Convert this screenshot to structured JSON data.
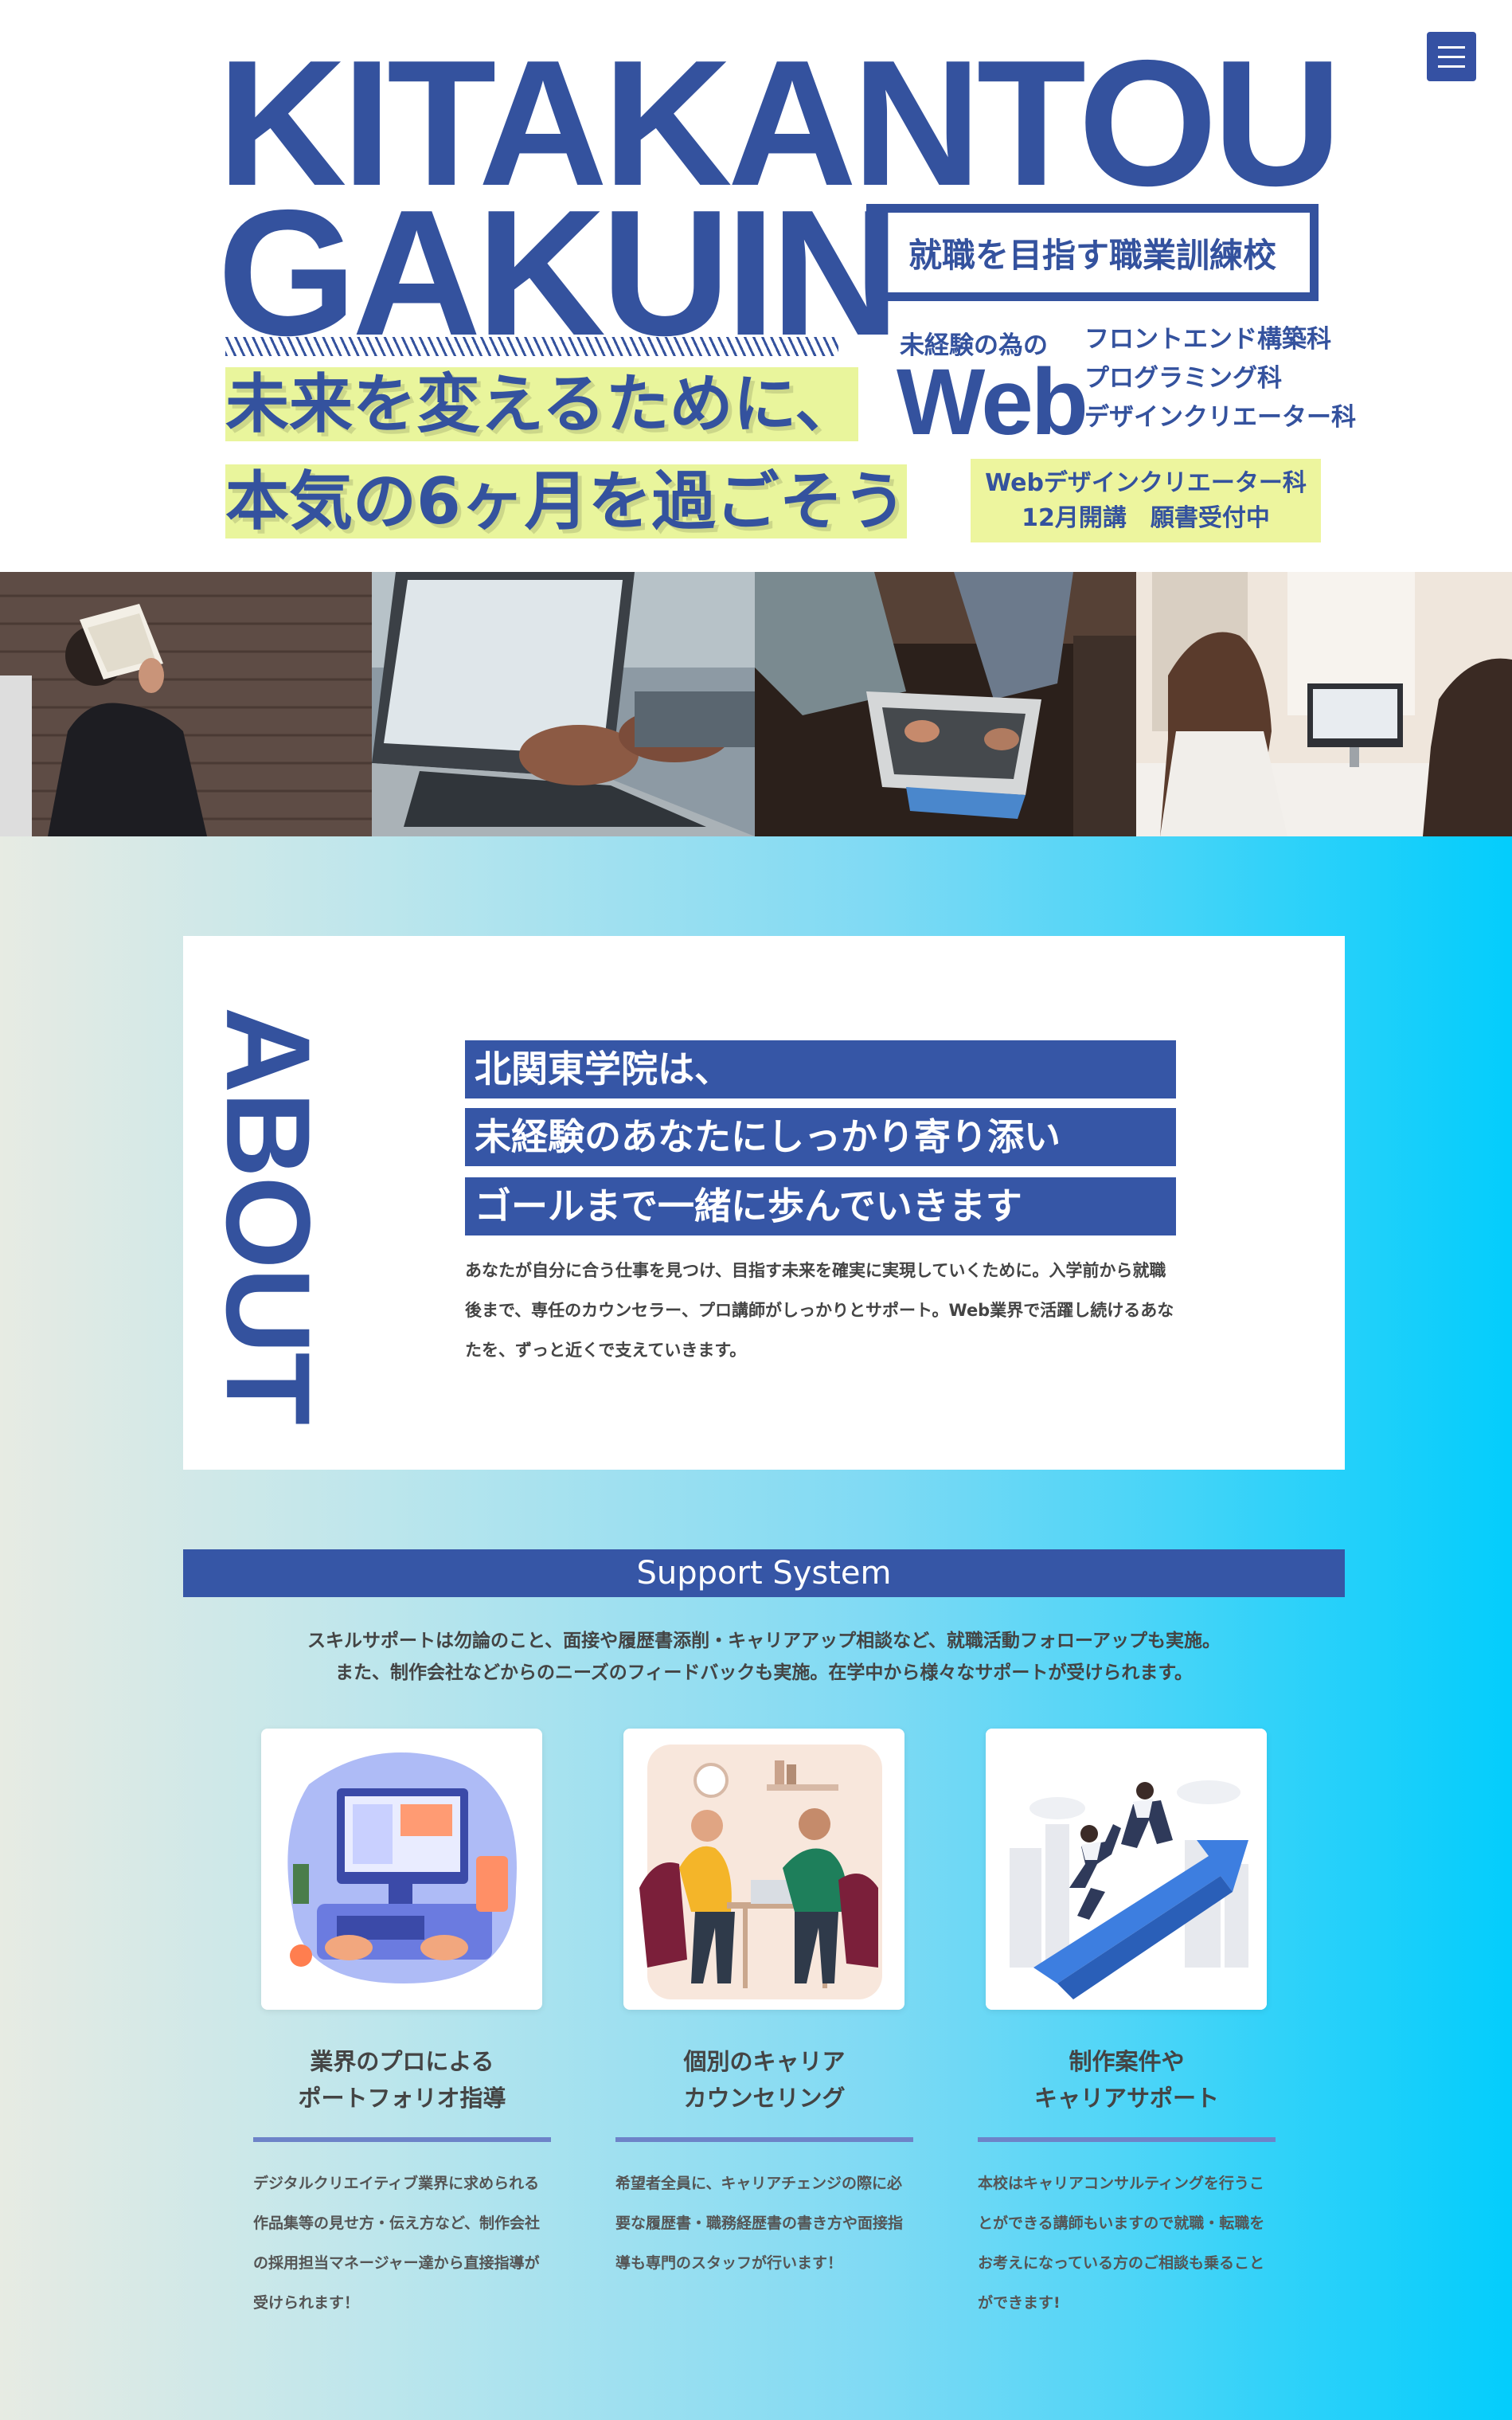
{
  "hero": {
    "title_line1": "KITAKANTOU",
    "title_line2": "GAKUIN",
    "badge": "就職を目指す職業訓練校",
    "for_beginners": "未経験の為の",
    "web_word": "Web",
    "courses": [
      "フロントエンド構築科",
      "プログラミング科",
      "デザインクリエーター科"
    ],
    "catch_line1": "未来を変えるために、",
    "catch_line2": "本気の6ヶ月を過ごそう",
    "notice_line1": "Webデザインクリエーター科",
    "notice_line2": "12月開講　願書受付中",
    "menu_icon": "hamburger-menu-icon"
  },
  "photos": [
    {
      "name": "photo-person-reading",
      "alt": "book over face against brick wall"
    },
    {
      "name": "photo-laptop-typing",
      "alt": "hands typing on laptop"
    },
    {
      "name": "photo-group-laptop",
      "alt": "group around laptop"
    },
    {
      "name": "photo-two-women-computer",
      "alt": "two women at computer"
    }
  ],
  "about": {
    "title": "ABOUT",
    "lines": [
      "北関東学院は、",
      "未経験のあなたにしっかり寄り添い",
      "ゴールまで一緒に歩んでいきます"
    ],
    "text": "あなたが自分に合う仕事を見つけ、目指す未来を確実に実現していくために。入学前から就職後まで、専任のカウンセラー、プロ講師がしっかりとサポート。Web業界で活躍し続けるあなたを、ずっと近くで支えていきます。"
  },
  "support": {
    "title": "Support System",
    "intro_line1": "スキルサポートは勿論のこと、面接や履歴書添削・キャリアアップ相談など、就職活動フォローアップも実施。",
    "intro_line2": "また、制作会社などからのニーズのフィードバックも実施。在学中から様々なサポートが受けられます。",
    "cards": [
      {
        "title_line1": "業界のプロによる",
        "title_line2": "ポートフォリオ指導",
        "text": "デジタルクリエイティブ業界に求められる作品集等の見せ方・伝え方など、制作会社の採用担当マネージャー達から直接指導が受けられます！"
      },
      {
        "title_line1": "個別のキャリア",
        "title_line2": "カウンセリング",
        "text": "希望者全員に、キャリアチェンジの際に必要な履歴書・職務経歴書の書き方や面接指導も専門のスタッフが行います！"
      },
      {
        "title_line1": "制作案件や",
        "title_line2": "キャリアサポート",
        "text": "本校はキャリアコンサルティングを行うことができる講師もいますので就職・転職をお考えになっている方のご相談も乗ることができます!"
      }
    ]
  },
  "colors": {
    "brand": "#34529e",
    "highlight": "#e9f59c",
    "gradient_end": "#03cdfc"
  }
}
